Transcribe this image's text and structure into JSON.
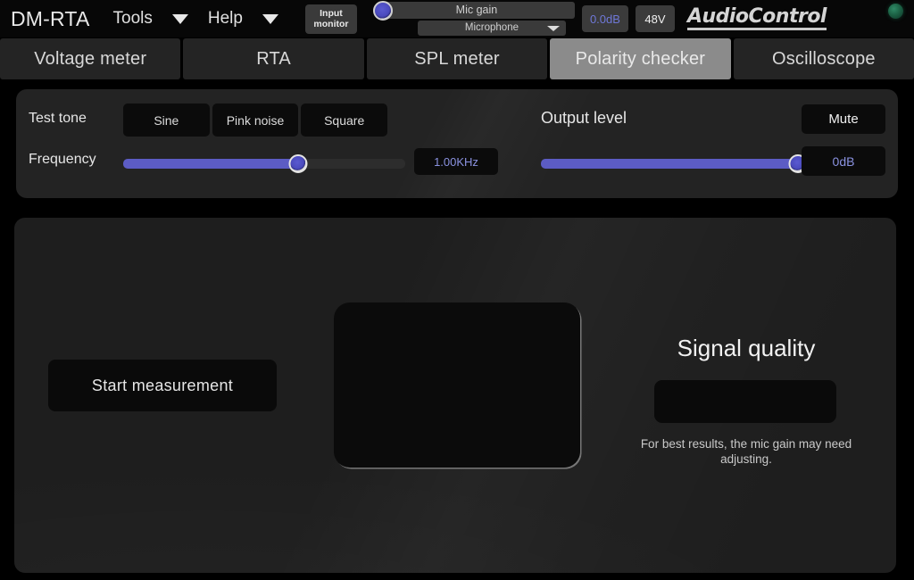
{
  "topbar": {
    "app_title": "DM-RTA",
    "menus": [
      {
        "label": "Tools",
        "icon": "chevron-down-icon"
      },
      {
        "label": "Help",
        "icon": "chevron-down-icon"
      }
    ],
    "input_monitor_line1": "Input",
    "input_monitor_line2": "monitor",
    "mic_gain_label": "Mic gain",
    "mic_source_label": "Microphone",
    "mic_source_icon": "chevron-down-icon",
    "gain_value": "0.0dB",
    "phantom_power": "48V",
    "brand": "AudioControl",
    "status_led": "power-led-green"
  },
  "tabs": [
    {
      "label": "Voltage meter",
      "active": false
    },
    {
      "label": "RTA",
      "active": false
    },
    {
      "label": "SPL meter",
      "active": false
    },
    {
      "label": "Polarity checker",
      "active": true
    },
    {
      "label": "Oscilloscope",
      "active": false
    }
  ],
  "controls": {
    "test_tone_label": "Test tone",
    "test_tone_options": [
      "Sine",
      "Pink noise",
      "Square"
    ],
    "frequency_label": "Frequency",
    "frequency_value": "1.00KHz",
    "frequency_percent": 62,
    "output_level_label": "Output level",
    "output_percent": 100,
    "mute_label": "Mute",
    "output_value": "0dB"
  },
  "main": {
    "start_button": "Start measurement",
    "scope_display": "",
    "signal_quality_title": "Signal quality",
    "signal_quality_value": "",
    "hint": "For best results, the mic gain may need adjusting."
  },
  "colors": {
    "accent_slider": "#5c5cc4",
    "accent_text": "#8a92e0",
    "tab_active_bg": "#8b8b8b",
    "panel_bg": "#1e1e1e",
    "led_green": "#2f8a66"
  }
}
